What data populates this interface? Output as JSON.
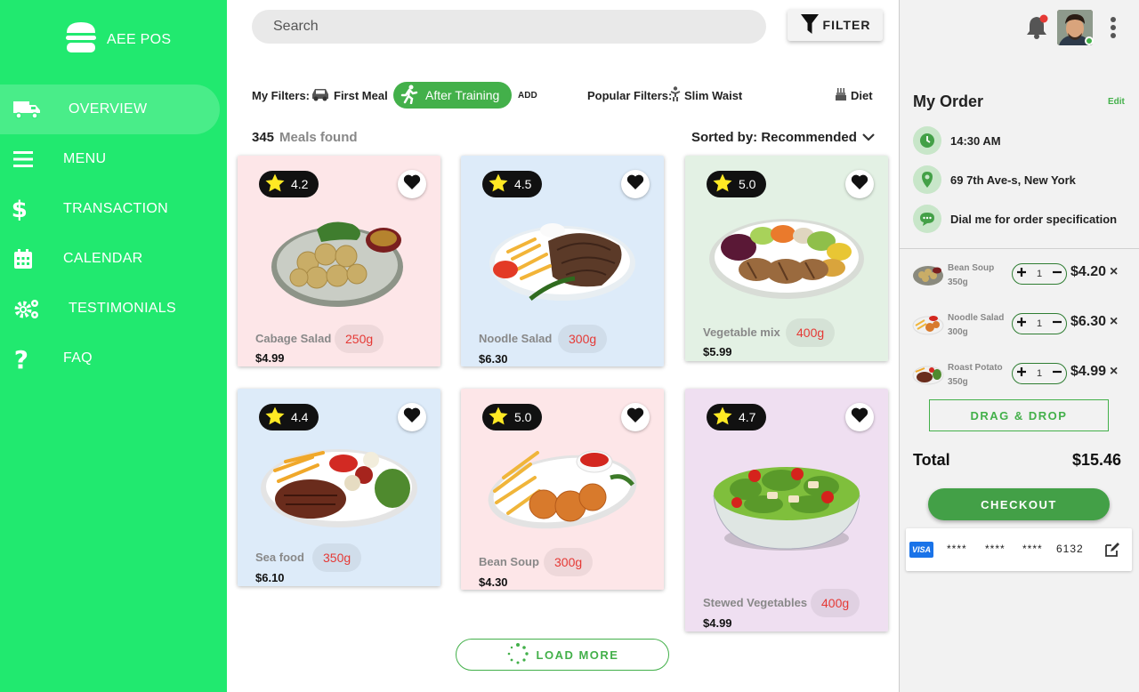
{
  "colors": {
    "sidebar": "#21e96f",
    "accent": "#43b04a",
    "price_red": "#e53935"
  },
  "brand": {
    "name": "AEE POS",
    "icon": "burger-icon"
  },
  "nav": [
    {
      "label": "OVERVIEW",
      "icon": "truck-icon",
      "active": true
    },
    {
      "label": "MENU",
      "icon": "menu-icon"
    },
    {
      "label": "TRANSACTION",
      "icon": "dollar-icon"
    },
    {
      "label": "CALENDAR",
      "icon": "calendar-icon"
    },
    {
      "label": "TESTIMONIALS",
      "icon": "gears-icon"
    },
    {
      "label": "FAQ",
      "icon": "question-icon"
    }
  ],
  "search": {
    "placeholder": "Search"
  },
  "filter_button": {
    "label": "FILTER",
    "icon": "funnel-icon"
  },
  "my_filters": {
    "label": "My Filters:",
    "items": [
      {
        "label": "First Meal",
        "icon": "car-icon"
      },
      {
        "label": "After Training",
        "icon": "runner-icon",
        "active": true
      }
    ],
    "add_label": "ADD"
  },
  "popular_filters": {
    "label": "Popular Filters:",
    "items": [
      {
        "label": "Slim Waist",
        "icon": "figure-icon"
      },
      {
        "label": "Diet",
        "icon": "cake-icon"
      }
    ]
  },
  "results": {
    "count": "345",
    "label": "Meals found"
  },
  "sort": {
    "label": "Sorted by: Recommended"
  },
  "meals": [
    {
      "name": "Cabage Salad",
      "weight": "250g",
      "price": "$4.99",
      "rating": "4.2",
      "bg": "#fde6e8"
    },
    {
      "name": "Noodle Salad",
      "weight": "300g",
      "price": "$6.30",
      "rating": "4.5",
      "bg": "#ddebf9"
    },
    {
      "name": "Vegetable mix",
      "weight": "400g",
      "price": "$5.99",
      "rating": "5.0",
      "bg": "#e3f1e4"
    },
    {
      "name": "Sea food",
      "weight": "350g",
      "price": "$6.10",
      "rating": "4.4",
      "bg": "#ddebf9"
    },
    {
      "name": "Bean Soup",
      "weight": "300g",
      "price": "$4.30",
      "rating": "5.0",
      "bg": "#fde6e8"
    },
    {
      "name": "Stewed Vegetables",
      "weight": "400g",
      "price": "$4.99",
      "rating": "4.7",
      "bg": "#efdff1"
    }
  ],
  "load_more": {
    "label": "LOAD MORE"
  },
  "order": {
    "title": "My Order",
    "edit_label": "Edit",
    "time": "14:30 AM",
    "address": "69 7th Ave-s, New York",
    "note": "Dial me for order specification",
    "items": [
      {
        "name": "Bean Soup",
        "weight": "350g",
        "qty": "1",
        "price": "$4.20"
      },
      {
        "name": "Noodle Salad",
        "weight": "300g",
        "qty": "1",
        "price": "$6.30"
      },
      {
        "name": "Roast Potato",
        "weight": "350g",
        "qty": "1",
        "price": "$4.99"
      }
    ],
    "drag_drop_label": "DRAG & DROP",
    "total_label": "Total",
    "total_value": "$15.46",
    "checkout_label": "CHECKOUT",
    "card": {
      "brand": "VISA",
      "groups": [
        "****",
        "****",
        "****",
        "6132"
      ]
    }
  }
}
